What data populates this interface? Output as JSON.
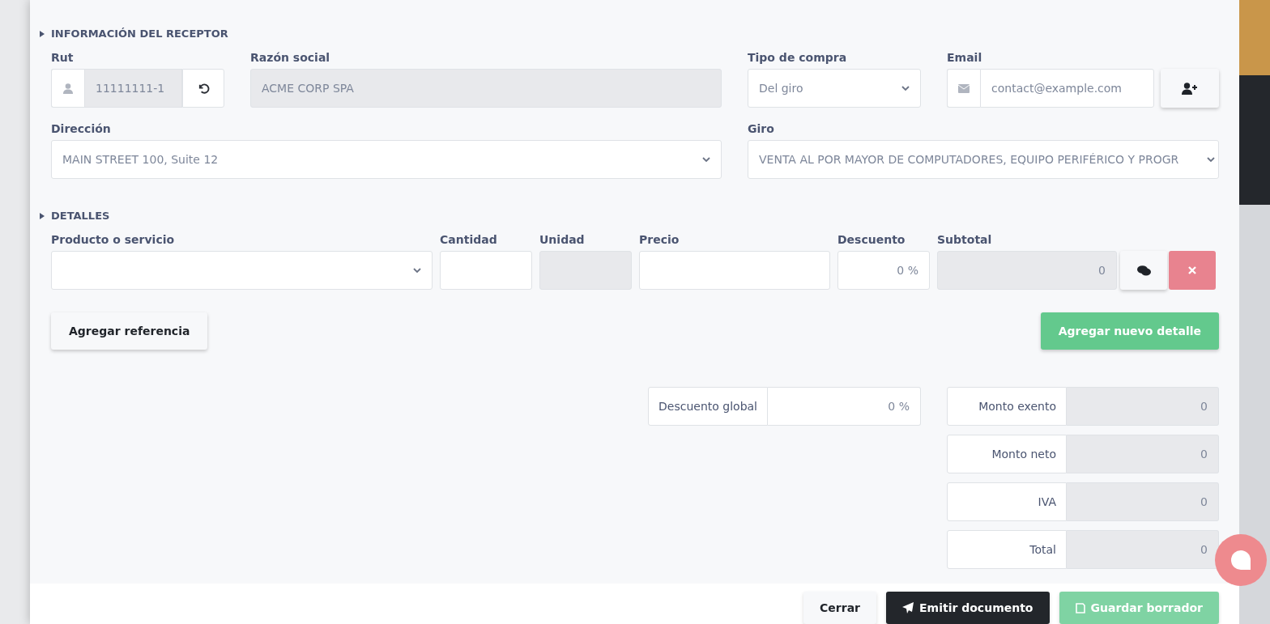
{
  "receptor": {
    "title": "INFORMACIÓN DEL RECEPTOR",
    "rut": {
      "label": "Rut",
      "value": "11111111-1"
    },
    "razon_social": {
      "label": "Razón social",
      "value": "ACME CORP SPA"
    },
    "tipo_compra": {
      "label": "Tipo de compra",
      "value": "Del giro"
    },
    "email": {
      "label": "Email",
      "value": "contact@example.com"
    },
    "direccion": {
      "label": "Dirección",
      "value": "MAIN STREET 100, Suite 12"
    },
    "giro": {
      "label": "Giro",
      "value": "VENTA AL POR MAYOR DE COMPUTADORES, EQUIPO PERIFÉRICO Y PROGR"
    }
  },
  "detalles": {
    "title": "DETALLES",
    "columns": [
      {
        "label": "Producto o servicio",
        "kind": "select"
      },
      {
        "label": "Cantidad",
        "kind": "input"
      },
      {
        "label": "Unidad",
        "kind": "readonly"
      },
      {
        "label": "Precio",
        "kind": "input"
      },
      {
        "label": "Descuento",
        "kind": "input",
        "value": "0 %"
      },
      {
        "label": "Subtotal",
        "kind": "readonly",
        "value": "0"
      }
    ],
    "add_reference": "Agregar referencia",
    "add_detail": "Agregar nuevo detalle"
  },
  "global_discount": {
    "label": "Descuento global",
    "value": "0 %"
  },
  "totals": [
    {
      "label": "Monto exento",
      "value": "0"
    },
    {
      "label": "Monto neto",
      "value": "0"
    },
    {
      "label": "IVA",
      "value": "0"
    },
    {
      "label": "Total",
      "value": "0"
    }
  ],
  "footer": {
    "close": "Cerrar",
    "emit": "Emitir documento",
    "save": "Guardar borrador"
  }
}
